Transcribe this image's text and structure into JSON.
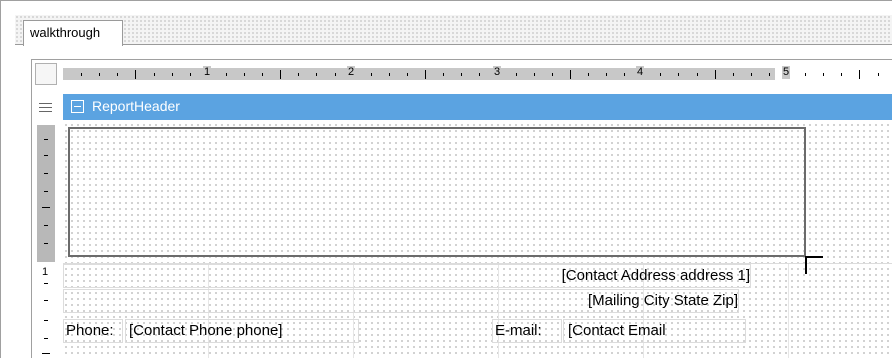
{
  "document_tab": {
    "label": "walkthrough"
  },
  "ruler": {
    "horizontal_numbers": [
      "1",
      "2",
      "3",
      "4",
      "5"
    ],
    "vertical_numbers": [
      "1"
    ]
  },
  "report_header": {
    "title": "ReportHeader",
    "band_color": "#5ba3e1",
    "collapse_icon": "minus-box-icon"
  },
  "fields": {
    "contact_address": "[Contact Address address 1]",
    "mailing_city": "[Mailing City State Zip]",
    "phone_label": "Phone:",
    "phone_value": "[Contact Phone phone]",
    "email_label": "E-mail:",
    "email_value": "[Contact Email"
  }
}
